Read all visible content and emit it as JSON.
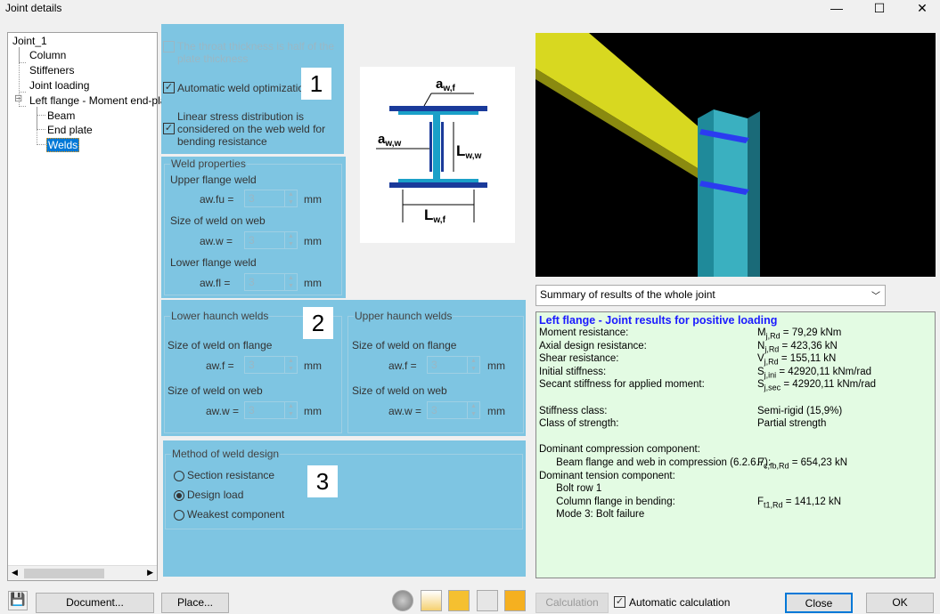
{
  "window": {
    "title": "Joint details",
    "min": "—",
    "max": "☐",
    "close": "✕"
  },
  "tree": {
    "root": "Joint_1",
    "items": [
      "Column",
      "Stiffeners",
      "Joint loading"
    ],
    "group": "Left flange - Moment end-pla",
    "children": [
      "Beam",
      "End plate",
      "Welds"
    ],
    "expander": "⊟"
  },
  "section1": {
    "number": "1",
    "throat": "The throat thickness is half of the plate thickness",
    "auto": "Automatic weld optimization",
    "linear": "Linear stress distribution is considered on the web weld for bending resistance",
    "check": "✓"
  },
  "weld_props": {
    "title": "Weld properties",
    "upper": "Upper flange weld",
    "upper_lbl": "aw.fu =",
    "upper_val": "3",
    "web": "Size of weld on web",
    "web_lbl": "aw.w =",
    "web_val": "3",
    "lower": "Lower flange weld",
    "lower_lbl": "aw.fl =",
    "lower_val": "3",
    "unit": "mm"
  },
  "figure": {
    "awf": "a",
    "awf_sub": "w,f",
    "aww": "a",
    "aww_sub": "w,w",
    "lww": "L",
    "lww_sub": "w,w",
    "lwf": "L",
    "lwf_sub": "w,f"
  },
  "section2": {
    "number": "2",
    "lower": {
      "title": "Lower haunch welds",
      "flange": "Size of weld on flange",
      "f_lbl": "aw.f =",
      "f_val": "3",
      "web": "Size of weld on web",
      "w_lbl": "aw.w =",
      "w_val": "3"
    },
    "upper": {
      "title": "Upper haunch welds",
      "flange": "Size of weld on flange",
      "f_lbl": "aw.f =",
      "f_val": "3",
      "web": "Size of weld on web",
      "w_lbl": "aw.w =",
      "w_val": "3"
    },
    "unit": "mm"
  },
  "section3": {
    "number": "3",
    "title": "Method of weld design",
    "options": [
      "Section resistance",
      "Design load",
      "Weakest component"
    ],
    "selected": "Design load"
  },
  "summary_select": "Summary of results of the whole joint",
  "results": {
    "heading": "Left flange - Joint results for positive loading",
    "rows": [
      {
        "l": "Moment resistance:",
        "s": "M",
        "sub": "j,Rd",
        "v": " = 79,29 kNm"
      },
      {
        "l": "Axial design resistance:",
        "s": "N",
        "sub": "j,Rd",
        "v": " = 423,36 kN"
      },
      {
        "l": "Shear resistance:",
        "s": "V",
        "sub": "j,Rd",
        "v": " = 155,11 kN"
      },
      {
        "l": "Initial stiffness:",
        "s": "S",
        "sub": "j,ini",
        "v": " = 42920,11 kNm/rad"
      },
      {
        "l": "Secant stiffness for applied moment:",
        "s": "S",
        "sub": "j,sec",
        "v": " = 42920,11 kNm/rad"
      },
      {
        "l": "",
        "s": "",
        "sub": "",
        "v": ""
      },
      {
        "l": "Stiffness class:",
        "s": "",
        "sub": "",
        "v": "Semi-rigid (15,9%)"
      },
      {
        "l": "Class of strength:",
        "s": "",
        "sub": "",
        "v": "Partial strength"
      },
      {
        "l": "",
        "s": "",
        "sub": "",
        "v": ""
      },
      {
        "l": "Dominant compression component:",
        "s": "",
        "sub": "",
        "v": ""
      },
      {
        "l": "      Beam flange and web in compression (6.2.6.7):",
        "s": "F",
        "sub": "c,fb,Rd",
        "v": " = 654,23 kN"
      },
      {
        "l": "Dominant tension component:",
        "s": "",
        "sub": "",
        "v": ""
      },
      {
        "l": "      Bolt row 1",
        "s": "",
        "sub": "",
        "v": ""
      },
      {
        "l": "      Column flange in bending:",
        "s": "F",
        "sub": "t1,Rd",
        "v": " = 141,12 kN"
      },
      {
        "l": "      Mode 3: Bolt failure",
        "s": "",
        "sub": "",
        "v": ""
      }
    ]
  },
  "footer": {
    "document": "Document...",
    "place": "Place...",
    "calculation": "Calculation",
    "auto_calc": "Automatic calculation",
    "close": "Close",
    "ok": "OK"
  }
}
